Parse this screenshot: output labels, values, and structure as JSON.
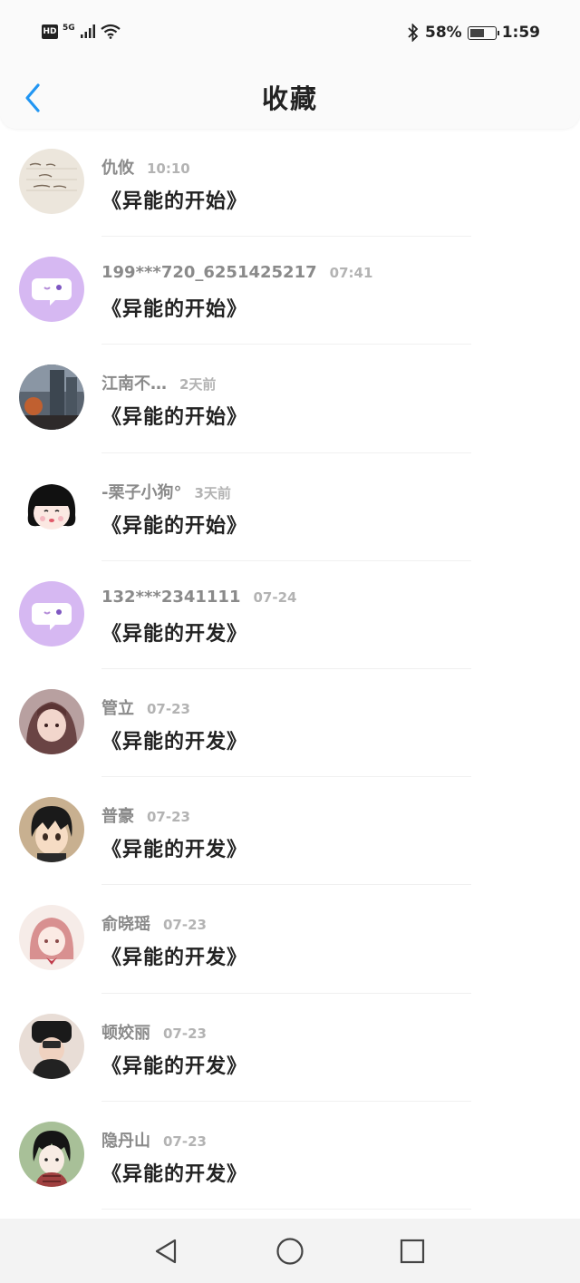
{
  "status_bar": {
    "hd": "HD",
    "network": "5G",
    "battery": "58%",
    "battery_level": 0.58,
    "time": "1:59"
  },
  "header": {
    "title": "收藏",
    "back_icon": "chevron-left-icon",
    "accent": "#2196f3"
  },
  "favorites": [
    {
      "user": "仇攸",
      "time": "10:10",
      "title": "《异能的开始》"
    },
    {
      "user": "199***720_6251425217",
      "time": "07:41",
      "title": "《异能的开始》"
    },
    {
      "user": "江南不…",
      "time": "2天前",
      "title": "《异能的开始》"
    },
    {
      "user": "-栗子小狗°",
      "time": "3天前",
      "title": "《异能的开始》"
    },
    {
      "user": "132***2341111",
      "time": "07-24",
      "title": "《异能的开发》"
    },
    {
      "user": "管立",
      "time": "07-23",
      "title": "《异能的开发》"
    },
    {
      "user": "普豪",
      "time": "07-23",
      "title": "《异能的开发》"
    },
    {
      "user": "俞晓瑶",
      "time": "07-23",
      "title": "《异能的开发》"
    },
    {
      "user": "顿姣丽",
      "time": "07-23",
      "title": "《异能的开发》"
    },
    {
      "user": "隐丹山",
      "time": "07-23",
      "title": "《异能的开发》"
    }
  ],
  "nav": {
    "back": "triangle-back-icon",
    "home": "circle-home-icon",
    "recents": "square-recents-icon"
  }
}
